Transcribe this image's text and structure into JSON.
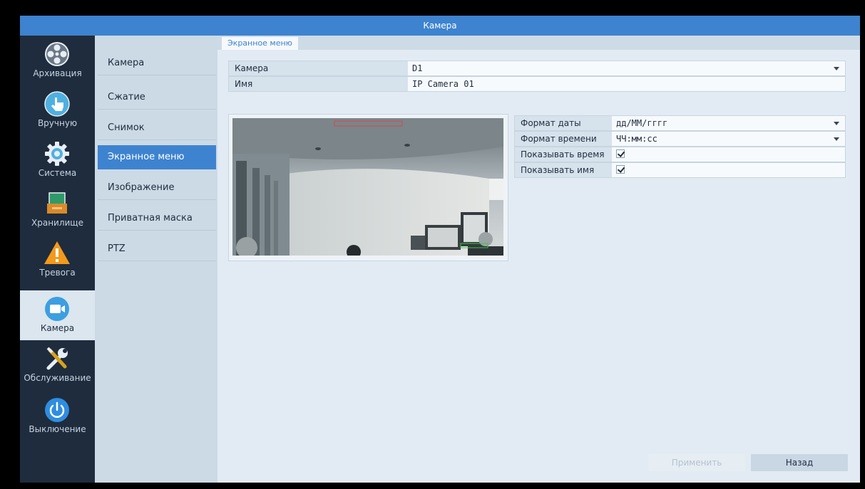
{
  "window": {
    "title": "Камера"
  },
  "sidebar": {
    "items": [
      {
        "label": "Архивация",
        "icon": "film-reel-icon"
      },
      {
        "label": "Вручную",
        "icon": "hand-pointer-icon"
      },
      {
        "label": "Система",
        "icon": "gear-icon"
      },
      {
        "label": "Хранилище",
        "icon": "storage-icon"
      },
      {
        "label": "Тревога",
        "icon": "warning-icon"
      },
      {
        "label": "Камера",
        "icon": "video-camera-icon",
        "active": true
      },
      {
        "label": "Обслуживание",
        "icon": "tools-icon"
      },
      {
        "label": "Выключение",
        "icon": "power-icon"
      }
    ]
  },
  "submenu": {
    "items": [
      {
        "label": "Камера"
      },
      {
        "label": "Сжатие"
      },
      {
        "label": "Снимок"
      },
      {
        "label": "Экранное меню",
        "active": true
      },
      {
        "label": "Изображение"
      },
      {
        "label": "Приватная маска"
      },
      {
        "label": "PTZ"
      }
    ]
  },
  "tabs": [
    {
      "label": "Экранное меню",
      "active": true
    }
  ],
  "form": {
    "camera": {
      "label": "Камера",
      "value": "D1"
    },
    "name": {
      "label": "Имя",
      "value": "IP Camera 01"
    }
  },
  "osd": {
    "date_format": {
      "label": "Формат даты",
      "value": "дд/ММ/гггг"
    },
    "time_format": {
      "label": "Формат времени",
      "value": "ЧЧ:мм:сс"
    },
    "show_time": {
      "label": "Показывать время",
      "checked": true
    },
    "show_name": {
      "label": "Показывать имя",
      "checked": true
    }
  },
  "buttons": {
    "apply": "Применить",
    "back": "Назад"
  },
  "colors": {
    "accent": "#3d83cf",
    "nav_bg": "#1f2c3d",
    "content_bg": "#e2ebf3"
  }
}
